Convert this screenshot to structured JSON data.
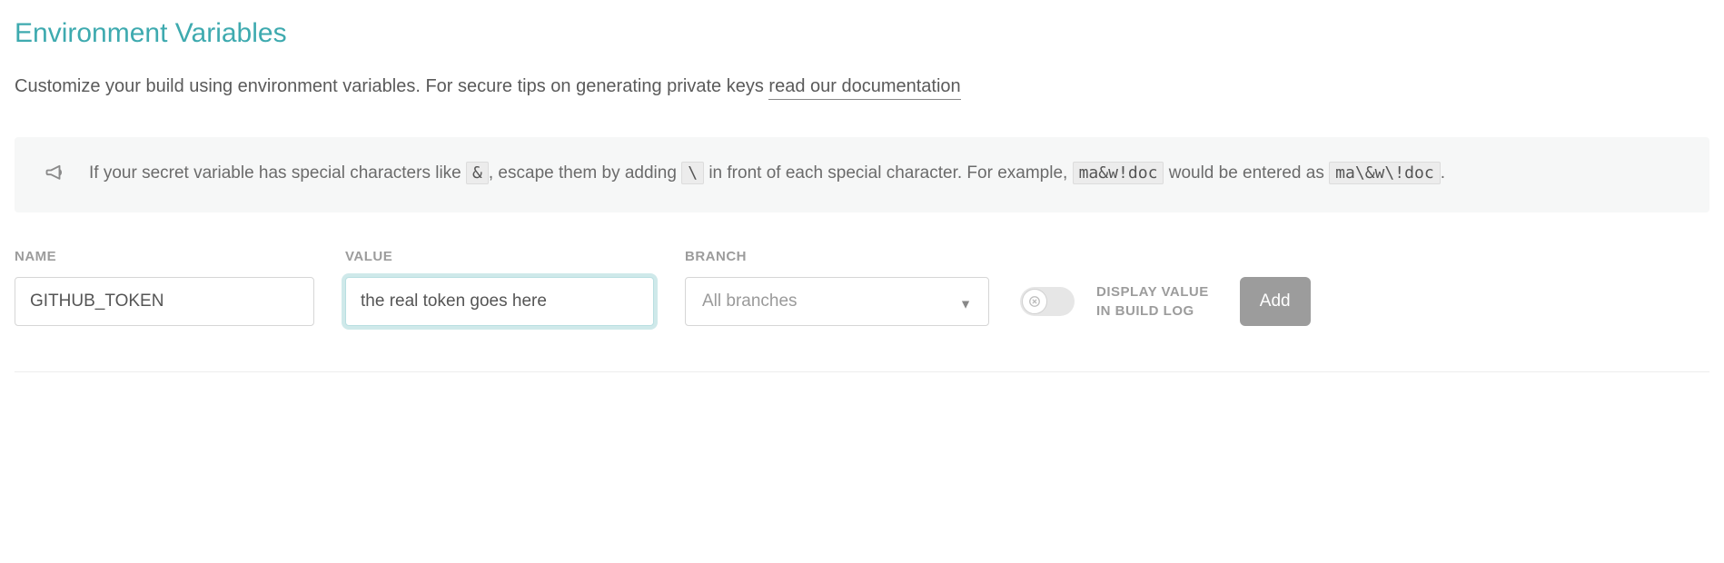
{
  "header": {
    "title": "Environment Variables",
    "subtitle_pre": "Customize your build using environment variables. For secure tips on generating private keys ",
    "doc_link": "read our documentation"
  },
  "notice": {
    "p1": "If your secret variable has special characters like ",
    "code1": "&",
    "p2": ", escape them by adding ",
    "code2": "\\",
    "p3": " in front of each special character. For example, ",
    "code3": "ma&w!doc",
    "p4": " would be entered as ",
    "code4": "ma\\&w\\!doc",
    "p5": "."
  },
  "form": {
    "name_label": "NAME",
    "name_value": "GITHUB_TOKEN",
    "value_label": "VALUE",
    "value_value": "the real token goes here",
    "branch_label": "BRANCH",
    "branch_selected": "All branches",
    "toggle_label_line1": "DISPLAY VALUE",
    "toggle_label_line2": "IN BUILD LOG",
    "toggle_on": false,
    "add_button": "Add"
  }
}
